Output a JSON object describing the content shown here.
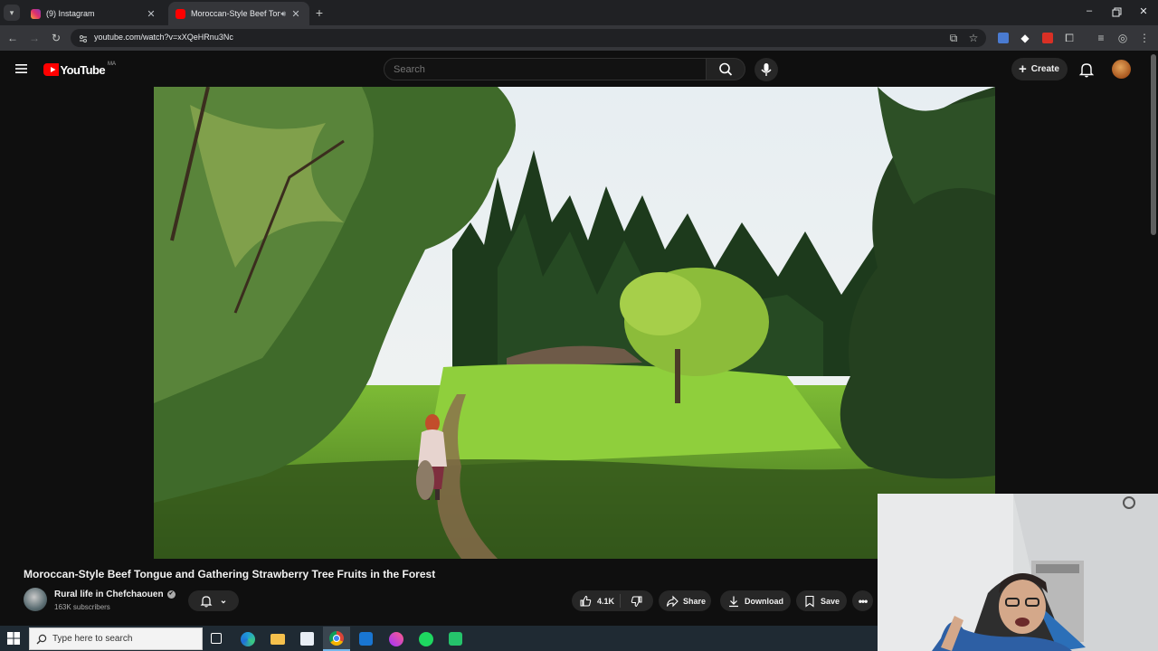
{
  "browser": {
    "tabs": [
      {
        "label": "(9) Instagram",
        "active": false,
        "favicon": "instagram-icon"
      },
      {
        "label": "Moroccan-Style Beef Tongue",
        "active": true,
        "favicon": "youtube-icon"
      }
    ],
    "url": "youtube.com/watch?v=xXQeHRnu3Nc"
  },
  "youtube": {
    "logo_text": "YouTube",
    "country_code": "MA",
    "search_placeholder": "Search",
    "create_label": "Create"
  },
  "video": {
    "title": "Moroccan-Style Beef Tongue and Gathering Strawberry Tree Fruits in the Forest",
    "channel_name": "Rural life in Chefchaouen",
    "verified": "✔",
    "subscribers": "163K subscribers",
    "like_count": "4.1K",
    "share_label": "Share",
    "download_label": "Download",
    "save_label": "Save"
  },
  "taskbar": {
    "search_placeholder": "Type here to search"
  },
  "colors": {
    "youtube_red": "#ff0000",
    "page_bg": "#0f0f0f",
    "pill_bg": "#272727"
  }
}
